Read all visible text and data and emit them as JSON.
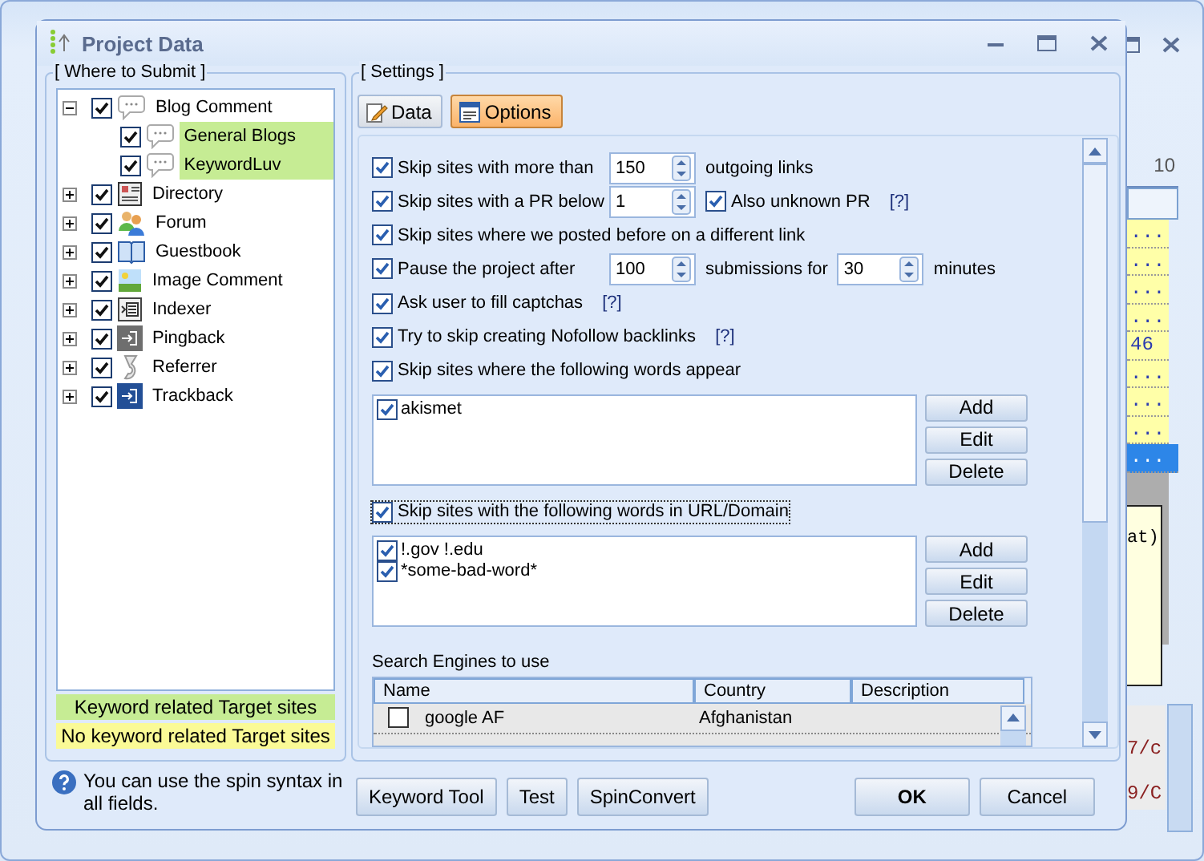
{
  "background_window": {
    "grid_header": "10",
    "grid_rows": [
      {
        "text": "...",
        "selected": false
      },
      {
        "text": "...",
        "selected": false
      },
      {
        "text": "...",
        "selected": false
      },
      {
        "text": "...",
        "selected": false
      },
      {
        "text": "46",
        "selected": false
      },
      {
        "text": "...",
        "selected": false
      },
      {
        "text": "...",
        "selected": false
      },
      {
        "text": "...",
        "selected": false
      },
      {
        "text": "...",
        "selected": true
      }
    ],
    "tooltip_text": "at)",
    "log_lines": [
      "7/c",
      "9/C"
    ]
  },
  "dialog": {
    "title": "Project Data"
  },
  "where_to_submit": {
    "title": "[ Where to Submit ]",
    "tree": [
      {
        "label": "Blog Comment",
        "checked": true,
        "expanded": true,
        "children": [
          {
            "label": "General Blogs",
            "checked": true,
            "color": "#c6ec94"
          },
          {
            "label": "KeywordLuv",
            "checked": true,
            "color": "#c6ec94"
          }
        ]
      },
      {
        "label": "Directory",
        "checked": true,
        "expanded": false
      },
      {
        "label": "Forum",
        "checked": true,
        "expanded": false
      },
      {
        "label": "Guestbook",
        "checked": true,
        "expanded": false
      },
      {
        "label": "Image Comment",
        "checked": true,
        "expanded": false
      },
      {
        "label": "Indexer",
        "checked": true,
        "expanded": false
      },
      {
        "label": "Pingback",
        "checked": true,
        "expanded": false
      },
      {
        "label": "Referrer",
        "checked": true,
        "expanded": false
      },
      {
        "label": "Trackback",
        "checked": true,
        "expanded": false
      }
    ],
    "legend": [
      {
        "text": "Keyword related Target sites",
        "color": "#c6ec94"
      },
      {
        "text": "No keyword related Target sites",
        "color": "#fafa96"
      }
    ],
    "help_text": "You can use the spin syntax in all fields."
  },
  "settings": {
    "title": "[ Settings ]",
    "tabs": [
      {
        "label": "Data",
        "selected": false
      },
      {
        "label": "Options",
        "selected": true
      }
    ],
    "options": [
      [
        {
          "kind": "checkbox",
          "label": "Skip sites with more than",
          "checked": true
        },
        {
          "kind": "spin",
          "value": "150"
        },
        {
          "kind": "text",
          "text": "outgoing links"
        }
      ],
      [
        {
          "kind": "checkbox",
          "label": "Skip sites with a PR below",
          "checked": true
        },
        {
          "kind": "spin",
          "value": "1"
        },
        {
          "kind": "checkbox",
          "label": "Also unknown PR",
          "checked": true
        },
        {
          "kind": "help",
          "text": "[?]"
        }
      ],
      [
        {
          "kind": "checkbox",
          "label": "Skip sites where we posted before on a different link",
          "checked": true
        }
      ],
      [
        {
          "kind": "checkbox",
          "label": "Pause the project after",
          "checked": true
        },
        {
          "kind": "spin",
          "value": "100"
        },
        {
          "kind": "text",
          "text": "submissions for"
        },
        {
          "kind": "spin",
          "value": "30"
        },
        {
          "kind": "text",
          "text": "minutes"
        }
      ],
      [
        {
          "kind": "checkbox",
          "label": "Ask user to fill captchas",
          "checked": true
        },
        {
          "kind": "help",
          "text": "[?]"
        }
      ],
      [
        {
          "kind": "checkbox",
          "label": "Try to skip creating Nofollow backlinks",
          "checked": true
        },
        {
          "kind": "help",
          "text": "[?]"
        }
      ]
    ],
    "word_filters": [
      {
        "label": "Skip sites where the following words appear",
        "checked": true,
        "focused": false,
        "words": [
          {
            "text": "akismet",
            "checked": true
          }
        ],
        "buttons": [
          "Add",
          "Edit",
          "Delete"
        ]
      },
      {
        "label": "Skip sites with the following words in URL/Domain",
        "checked": true,
        "focused": true,
        "words": [
          {
            "text": "!.gov !.edu",
            "checked": true
          },
          {
            "text": "*some-bad-word*",
            "checked": true
          }
        ],
        "buttons": [
          "Add",
          "Edit",
          "Delete"
        ]
      }
    ],
    "search_engines": {
      "title": "Search Engines to use",
      "columns": [
        "Name",
        "Country",
        "Description"
      ],
      "rows": [
        {
          "checked": false,
          "cells": [
            "google AF",
            "Afghanistan",
            ""
          ]
        }
      ]
    }
  },
  "buttons": [
    {
      "label": "Keyword Tool",
      "default": false
    },
    {
      "label": "Test",
      "default": false
    },
    {
      "label": "SpinConvert",
      "default": false
    },
    {
      "label": "OK",
      "default": true
    },
    {
      "label": "Cancel",
      "default": false
    }
  ]
}
